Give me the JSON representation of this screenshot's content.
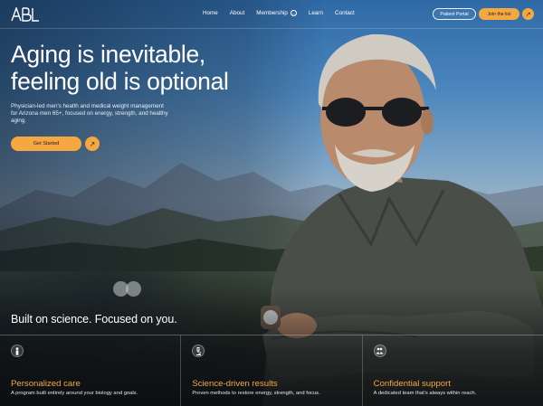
{
  "brand": {
    "logo_text": "ABL",
    "accent": "#f5a841"
  },
  "nav": {
    "links": [
      {
        "label": "Home"
      },
      {
        "label": "About"
      },
      {
        "label": "Membership",
        "has_dropdown": true
      },
      {
        "label": "Learn"
      },
      {
        "label": "Contact"
      }
    ],
    "patient_portal": "Patient Portal",
    "join": "Join the list"
  },
  "hero": {
    "headline_line1": "Aging is inevitable,",
    "headline_line2": "feeling old is optional",
    "subtext": "Physician-led men's health and medical weight management for Arizona men 65+, focused on energy, strength, and healthy aging.",
    "cta": "Get Started",
    "tagline": "Built on science.  Focused on you."
  },
  "features": [
    {
      "icon": "person-icon",
      "title": "Personalized care",
      "desc": "A program built entirely around your biology and goals."
    },
    {
      "icon": "microscope-icon",
      "title": "Science-driven results",
      "desc": "Proven methods to restore energy, strength, and focus."
    },
    {
      "icon": "people-icon",
      "title": "Confidential support",
      "desc": "A dedicated team that's always within reach."
    }
  ]
}
